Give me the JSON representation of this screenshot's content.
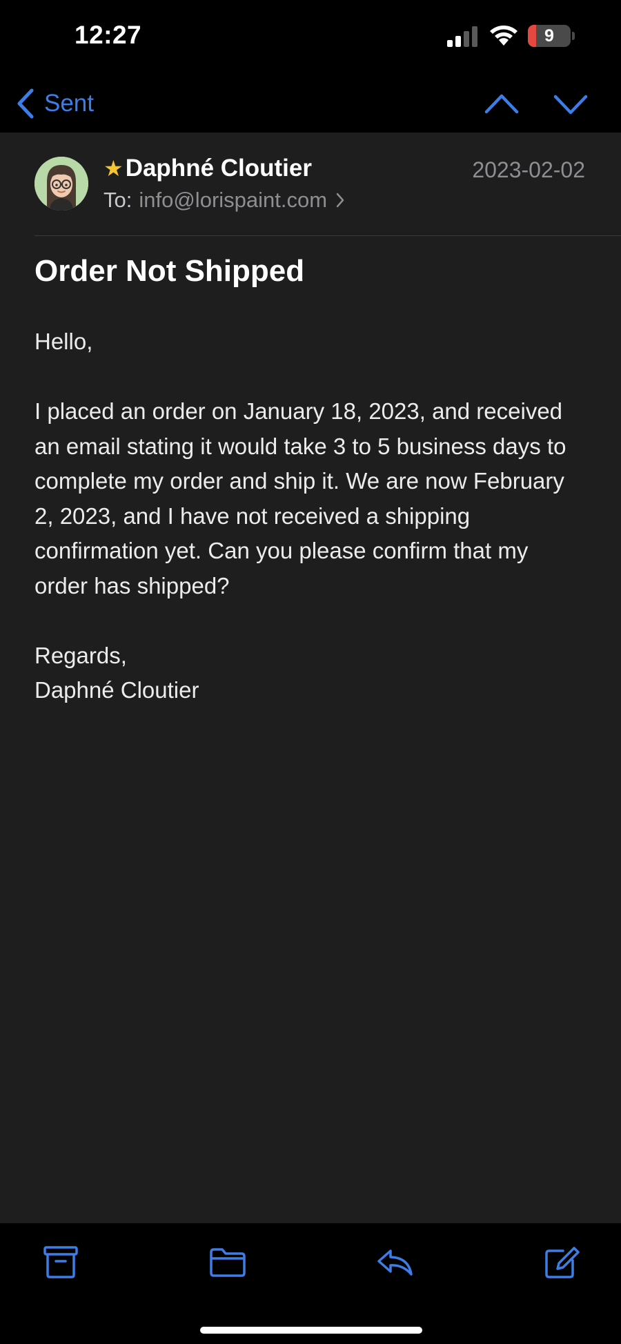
{
  "status_bar": {
    "time": "12:27",
    "battery_level": "9",
    "battery_fraction": 0.09,
    "signal_bars_active": 2,
    "signal_bars_total": 4
  },
  "nav": {
    "back_label": "Sent",
    "accent_color": "#3d7de6",
    "prev_icon": "chevron-up-icon",
    "next_icon": "chevron-down-icon"
  },
  "email": {
    "sender_name": "Daphné Cloutier",
    "flagged": true,
    "star_color": "#f5c431",
    "date": "2023-02-02",
    "to_label": "To:",
    "to_address": "info@lorispaint.com",
    "subject": "Order Not Shipped",
    "body": {
      "greeting": "Hello,",
      "paragraph": "I placed an order on January 18, 2023, and received an email stating it would take 3 to 5 business days to complete my order and ship it. We are now February 2, 2023, and I have not received a shipping confirmation yet. Can you please confirm that my order has shipped?",
      "closing": "Regards,",
      "signature": "Daphné Cloutier"
    }
  },
  "toolbar": {
    "items": [
      {
        "icon": "archive-box-icon"
      },
      {
        "icon": "folder-icon"
      },
      {
        "icon": "reply-icon"
      },
      {
        "icon": "compose-icon"
      }
    ]
  }
}
